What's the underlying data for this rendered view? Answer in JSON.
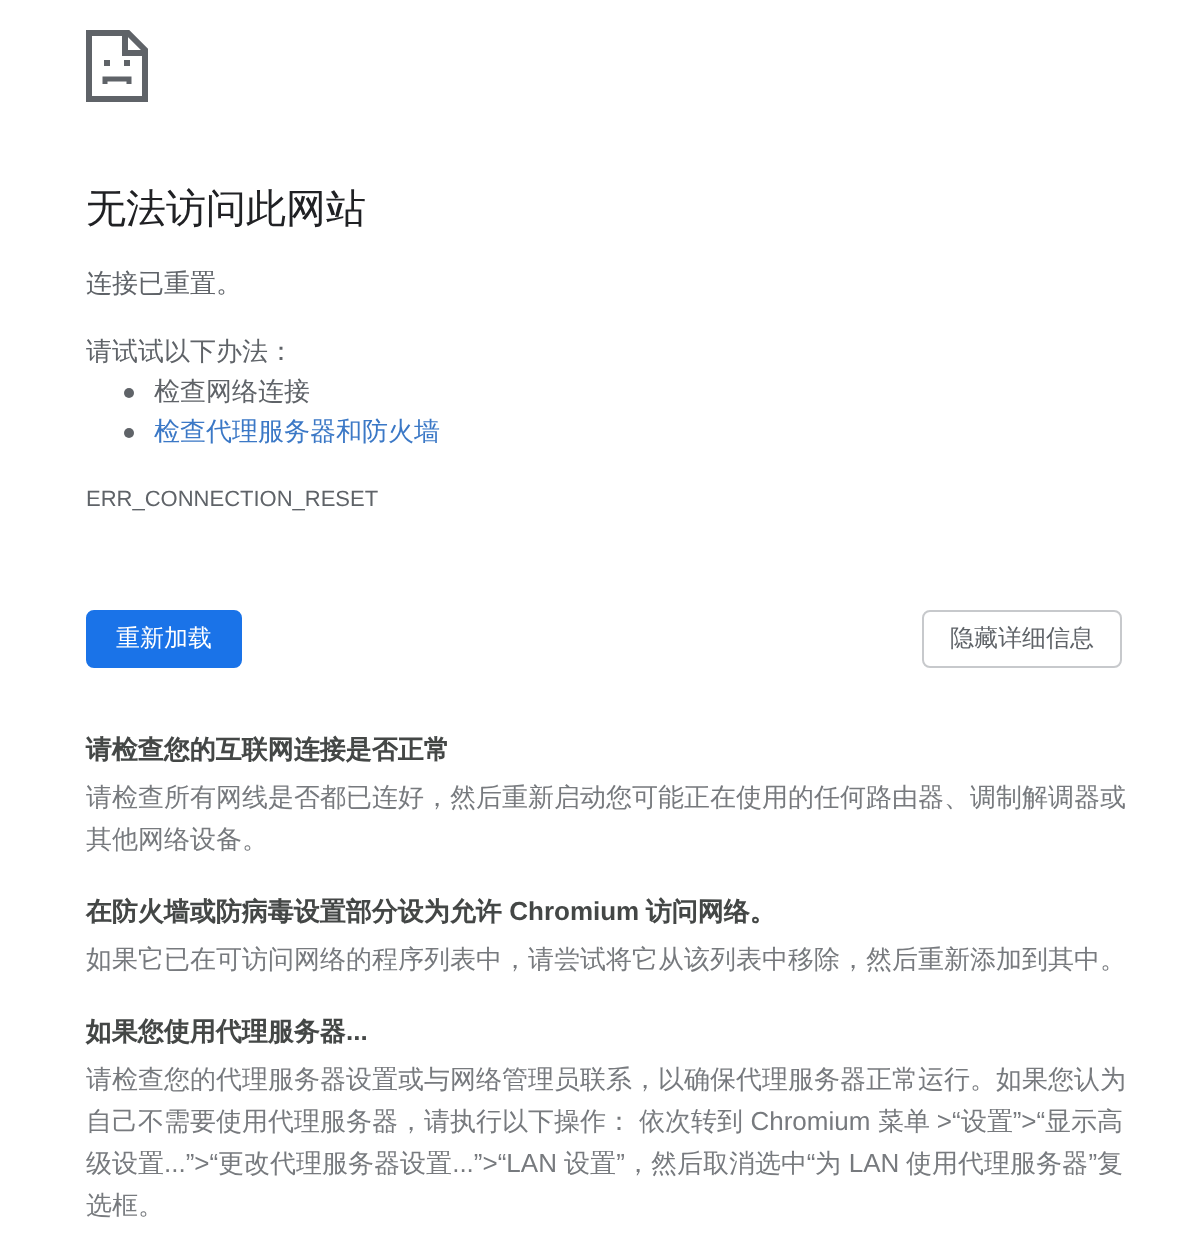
{
  "title": "无法访问此网站",
  "subtitle": "连接已重置。",
  "suggestions": {
    "heading": "请试试以下办法：",
    "items": [
      {
        "kind": "text",
        "text": "检查网络连接"
      },
      {
        "kind": "link",
        "text": "检查代理服务器和防火墙"
      }
    ]
  },
  "error_code": "ERR_CONNECTION_RESET",
  "buttons": [
    {
      "kind": "primary",
      "label": "重新加载"
    },
    {
      "kind": "secondary",
      "label": "隐藏详细信息"
    }
  ],
  "details": [
    {
      "heading": "请检查您的互联网连接是否正常",
      "body": "请检查所有网线是否都已连好，然后重新启动您可能正在使用的任何路由器、调制解调器或其他网络设备。"
    },
    {
      "heading": "在防火墙或防病毒设置部分设为允许 Chromium 访问网络。",
      "body": "如果它已在可访问网络的程序列表中，请尝试将它从该列表中移除，然后重新添加到其中。"
    },
    {
      "heading": "如果您使用代理服务器...",
      "body": "请检查您的代理服务器设置或与网络管理员联系，以确保代理服务器正常运行。如果您认为自己不需要使用代理服务器，请执行以下操作： 依次转到 Chromium 菜单 >“设置”>“显示高级设置...”>“更改代理服务器设置...”>“LAN 设置”，然后取消选中“为 LAN 使用代理服务器”复选框。"
    }
  ]
}
